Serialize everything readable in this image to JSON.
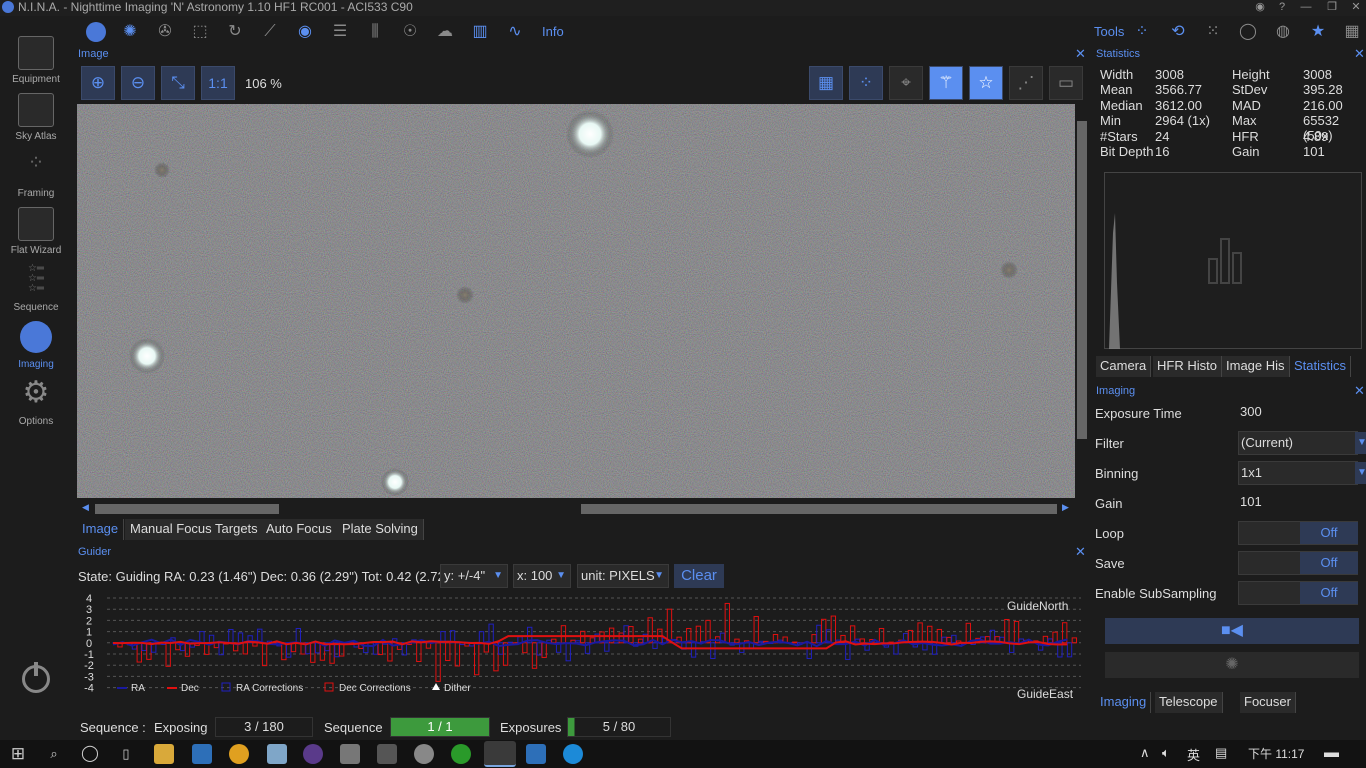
{
  "window": {
    "title": "N.I.N.A. - Nighttime Imaging 'N' Astronomy 1.10 HF1 RC001  -  ACI533 C90"
  },
  "sidebar": {
    "items": [
      {
        "label": "Equipment",
        "icon": "camera-icon"
      },
      {
        "label": "Sky Atlas",
        "icon": "atlas-icon"
      },
      {
        "label": "Framing",
        "icon": "framing-icon"
      },
      {
        "label": "Flat Wizard",
        "icon": "flat-wizard-icon"
      },
      {
        "label": "Sequence",
        "icon": "sequence-icon"
      },
      {
        "label": "Imaging",
        "icon": "imaging-icon"
      },
      {
        "label": "Options",
        "icon": "gear-icon"
      }
    ],
    "active": "Imaging"
  },
  "topbar": {
    "info_label": "Info",
    "tools_label": "Tools"
  },
  "image_panel": {
    "title": "Image",
    "zoom_label": "1:1",
    "zoom_value": "106 %",
    "tabs": [
      "Image",
      "Manual Focus Targets",
      "Auto Focus",
      "Plate Solving"
    ],
    "active_tab": "Image"
  },
  "guider": {
    "title": "Guider",
    "state": "State: Guiding  RA: 0.23 (1.46\")  Dec: 0.36 (2.29\")  Tot: 0.42 (2.72\")",
    "y_scale": "y: +/-4\"",
    "x_scale": "x: 100",
    "unit": "unit: PIXELS",
    "clear": "Clear",
    "north": "GuideNorth",
    "east": "GuideEast",
    "legend": [
      "RA",
      "Dec",
      "RA Corrections",
      "Dec Corrections",
      "Dither"
    ],
    "y_ticks": [
      "4",
      "3",
      "2",
      "1",
      "0",
      "-1",
      "-2",
      "-3",
      "-4"
    ]
  },
  "statistics": {
    "title": "Statistics",
    "rows": [
      {
        "l1": "Width",
        "v1": "3008",
        "l2": "Height",
        "v2": "3008"
      },
      {
        "l1": "Mean",
        "v1": "3566.77",
        "l2": "StDev",
        "v2": "395.28"
      },
      {
        "l1": "Median",
        "v1": "3612.00",
        "l2": "MAD",
        "v2": "216.00"
      },
      {
        "l1": "Min",
        "v1": "2964 (1x)",
        "l2": "Max",
        "v2": "65532 (50x)"
      },
      {
        "l1": "#Stars",
        "v1": "24",
        "l2": "HFR",
        "v2": "4.89"
      },
      {
        "l1": "Bit Depth",
        "v1": "16",
        "l2": "Gain",
        "v2": "101"
      }
    ],
    "tabs": [
      "Camera",
      "HFR Histo",
      "Image His",
      "Statistics"
    ],
    "active_tab": "Statistics"
  },
  "imaging": {
    "title": "Imaging",
    "exposure_label": "Exposure Time",
    "exposure_value": "300",
    "filter_label": "Filter",
    "filter_value": "(Current)",
    "binning_label": "Binning",
    "binning_value": "1x1",
    "gain_label": "Gain",
    "gain_value": "101",
    "loop_label": "Loop",
    "loop_value": "Off",
    "save_label": "Save",
    "save_value": "Off",
    "subsample_label": "Enable SubSampling",
    "subsample_value": "Off",
    "tabs": [
      "Imaging",
      "Telescope",
      "Focuser"
    ],
    "active_tab": "Imaging"
  },
  "statusbar": {
    "seq_label": "Sequence :",
    "seq_state": "Exposing",
    "seq_count": "3 / 180",
    "sequence_label": "Sequence",
    "sequence_val": "1 / 1",
    "exposures_label": "Exposures",
    "exposures_val": "5 / 80"
  },
  "taskbar": {
    "ime": "英",
    "time": "下午 11:17"
  },
  "colors": {
    "accent": "#5b8ff0",
    "green": "#3d9a3d",
    "ra": "#1a1aa0",
    "dec": "#e01010"
  }
}
